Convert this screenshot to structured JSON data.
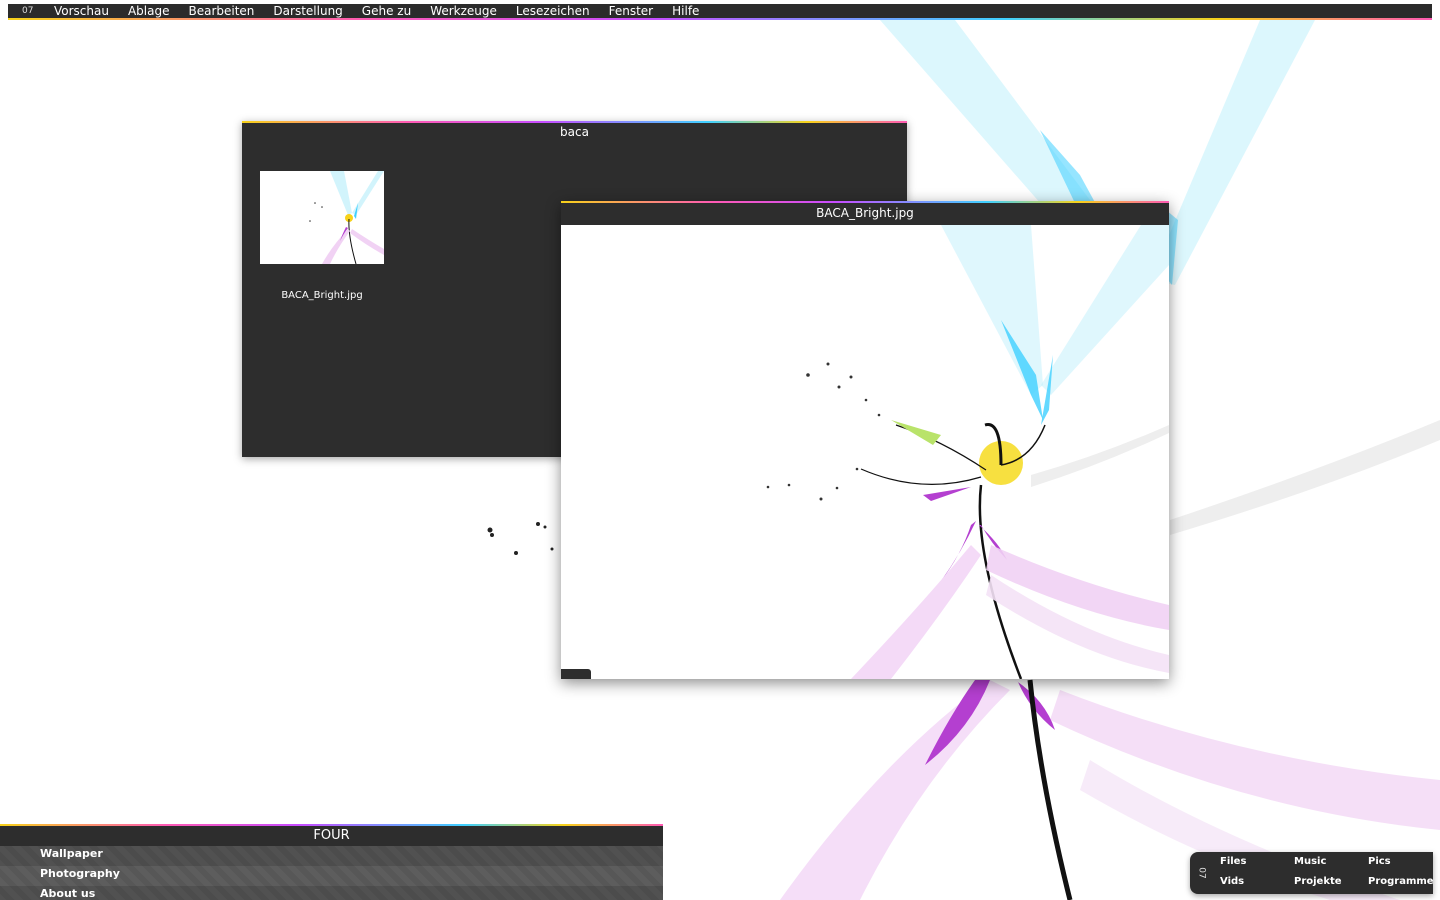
{
  "menubar": {
    "logo": "07",
    "items": [
      "Vorschau",
      "Ablage",
      "Bearbeiten",
      "Darstellung",
      "Gehe zu",
      "Werkzeuge",
      "Lesezeichen",
      "Fenster",
      "Hilfe"
    ]
  },
  "finder_window": {
    "title": "baca",
    "files": [
      {
        "name": "BACA_Bright.jpg"
      }
    ]
  },
  "preview_window": {
    "title": "BACA_Bright.jpg"
  },
  "four_panel": {
    "title": "FOUR",
    "links": [
      "Wallpaper",
      "Photography",
      "About us"
    ]
  },
  "dock": {
    "logo": "07",
    "items": [
      "Files",
      "Music",
      "Pics",
      "Vids",
      "Projekte",
      "Programme"
    ]
  },
  "colors": {
    "bar": "#2d2d2d",
    "cyan": "#3fd0ff",
    "magenta": "#c74cff",
    "pink": "#ff8fd6",
    "yellow": "#f7d21a"
  }
}
